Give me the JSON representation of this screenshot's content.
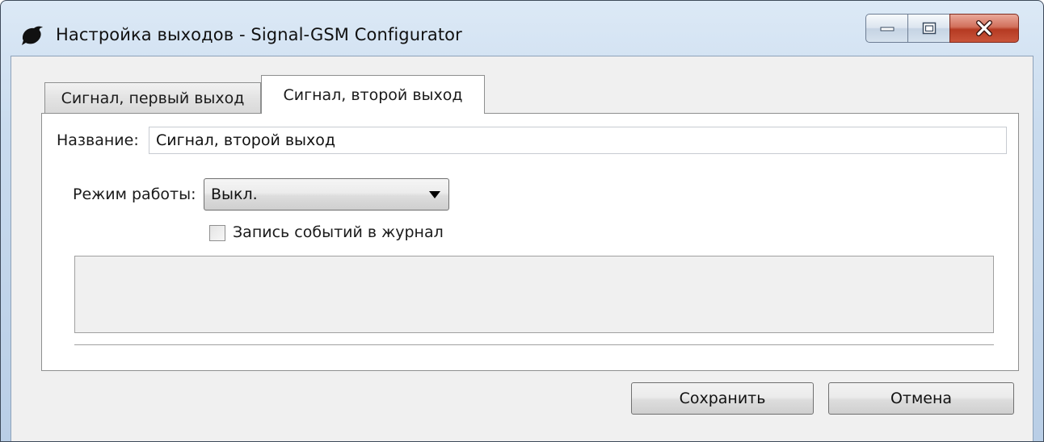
{
  "window": {
    "title": "Настройка выходов - Signal-GSM Configurator",
    "icon": "bird-app-icon"
  },
  "caption_buttons": {
    "minimize": "minimize-icon",
    "maximize": "maximize-icon",
    "close": "X"
  },
  "tabs": [
    {
      "label": "Сигнал, первый выход",
      "active": false
    },
    {
      "label": "Сигнал, второй выход",
      "active": true
    }
  ],
  "form": {
    "name_label": "Название:",
    "name_value": "Сигнал, второй выход",
    "mode_label": "Режим работы:",
    "mode_value": "Выкл.",
    "log_checkbox_label": "Запись событий в журнал",
    "log_checkbox_checked": false
  },
  "buttons": {
    "save": "Сохранить",
    "cancel": "Отмена"
  }
}
